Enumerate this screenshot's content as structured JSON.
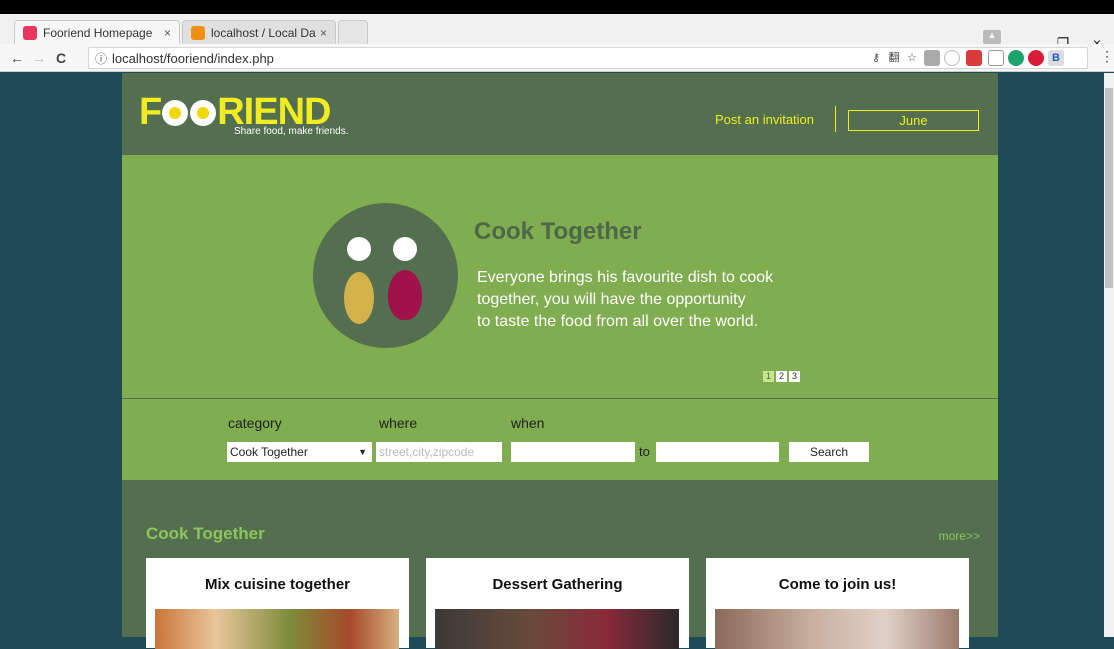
{
  "browser": {
    "tabs": [
      {
        "title": "Fooriend Homepage",
        "close": "×"
      },
      {
        "title": "localhost / Local Datab",
        "close": "×"
      }
    ],
    "url": "localhost/fooriend/index.php",
    "window_controls": [
      "–",
      "❐",
      "×"
    ],
    "nav": {
      "back": "←",
      "forward": "→",
      "reload": "C",
      "info": "ⓘ"
    },
    "extensions": [
      "⚲",
      "☆"
    ]
  },
  "header": {
    "logo": {
      "pre": "F",
      "post": "RIEND"
    },
    "tagline": "Share food, make friends.",
    "post_invitation": "Post an invitation",
    "user": "June"
  },
  "hero": {
    "title": "Cook Together",
    "text_lines": [
      "Everyone brings his favourite dish to cook",
      "together, you will have the opportunity",
      "to taste the food from all over the world."
    ],
    "pages": [
      "1",
      "2",
      "3"
    ]
  },
  "search": {
    "category_label": "category",
    "where_label": "where",
    "when_label": "when",
    "category_value": "Cook Together",
    "where_placeholder": "street,city,zipcode",
    "to_label": "to",
    "button": "Search"
  },
  "section": {
    "title": "Cook Together",
    "more": "more>>",
    "cards": [
      {
        "title": "Mix cuisine together"
      },
      {
        "title": "Dessert Gathering"
      },
      {
        "title": "Come to join us!"
      }
    ]
  }
}
